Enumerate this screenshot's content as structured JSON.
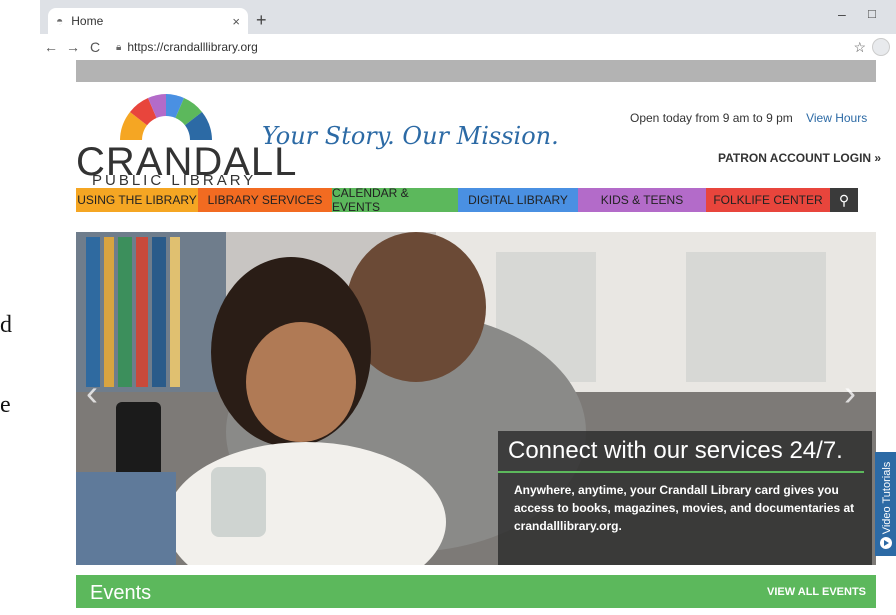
{
  "left_doc": {
    "frag1": "d",
    "frag2": "e"
  },
  "browser": {
    "tab_title": "Home",
    "tab_close": "×",
    "new_tab": "+",
    "url": "https://crandalllibrary.org",
    "minimize": "–",
    "maximize": "□",
    "back": "←",
    "forward": "→",
    "reload": "C",
    "star": "☆"
  },
  "header": {
    "logo_name": "CRANDALL",
    "logo_sub": "PUBLIC LIBRARY",
    "tagline": "Your Story. Our Mission.",
    "hours_text": "Open today from 9 am to 9 pm",
    "hours_link": "View Hours",
    "patron_login": "PATRON ACCOUNT LOGIN »"
  },
  "nav": {
    "items": [
      {
        "label": "USING THE LIBRARY",
        "color": "#f5a623"
      },
      {
        "label": "LIBRARY SERVICES",
        "color": "#f26b21"
      },
      {
        "label": "CALENDAR & EVENTS",
        "color": "#5cb85c"
      },
      {
        "label": "DIGITAL LIBRARY",
        "color": "#4a90e2"
      },
      {
        "label": "KIDS & TEENS",
        "color": "#b36bc9"
      },
      {
        "label": "FOLKLIFE CENTER",
        "color": "#e8453c"
      }
    ],
    "search_icon": "⚲"
  },
  "hero": {
    "heading": "Connect with our services 24/7.",
    "body": "Anywhere, anytime, your Crandall Library card gives you access to books, magazines, movies, and documentaries at crandalllibrary.org.",
    "prev": "‹",
    "next": "›"
  },
  "events": {
    "title": "Events",
    "view_all": "VIEW ALL EVENTS"
  },
  "video_tab": {
    "label": "Video Tutorials"
  },
  "colors": {
    "accent_green": "#5cb85c",
    "link_blue": "#2c6aa5"
  }
}
